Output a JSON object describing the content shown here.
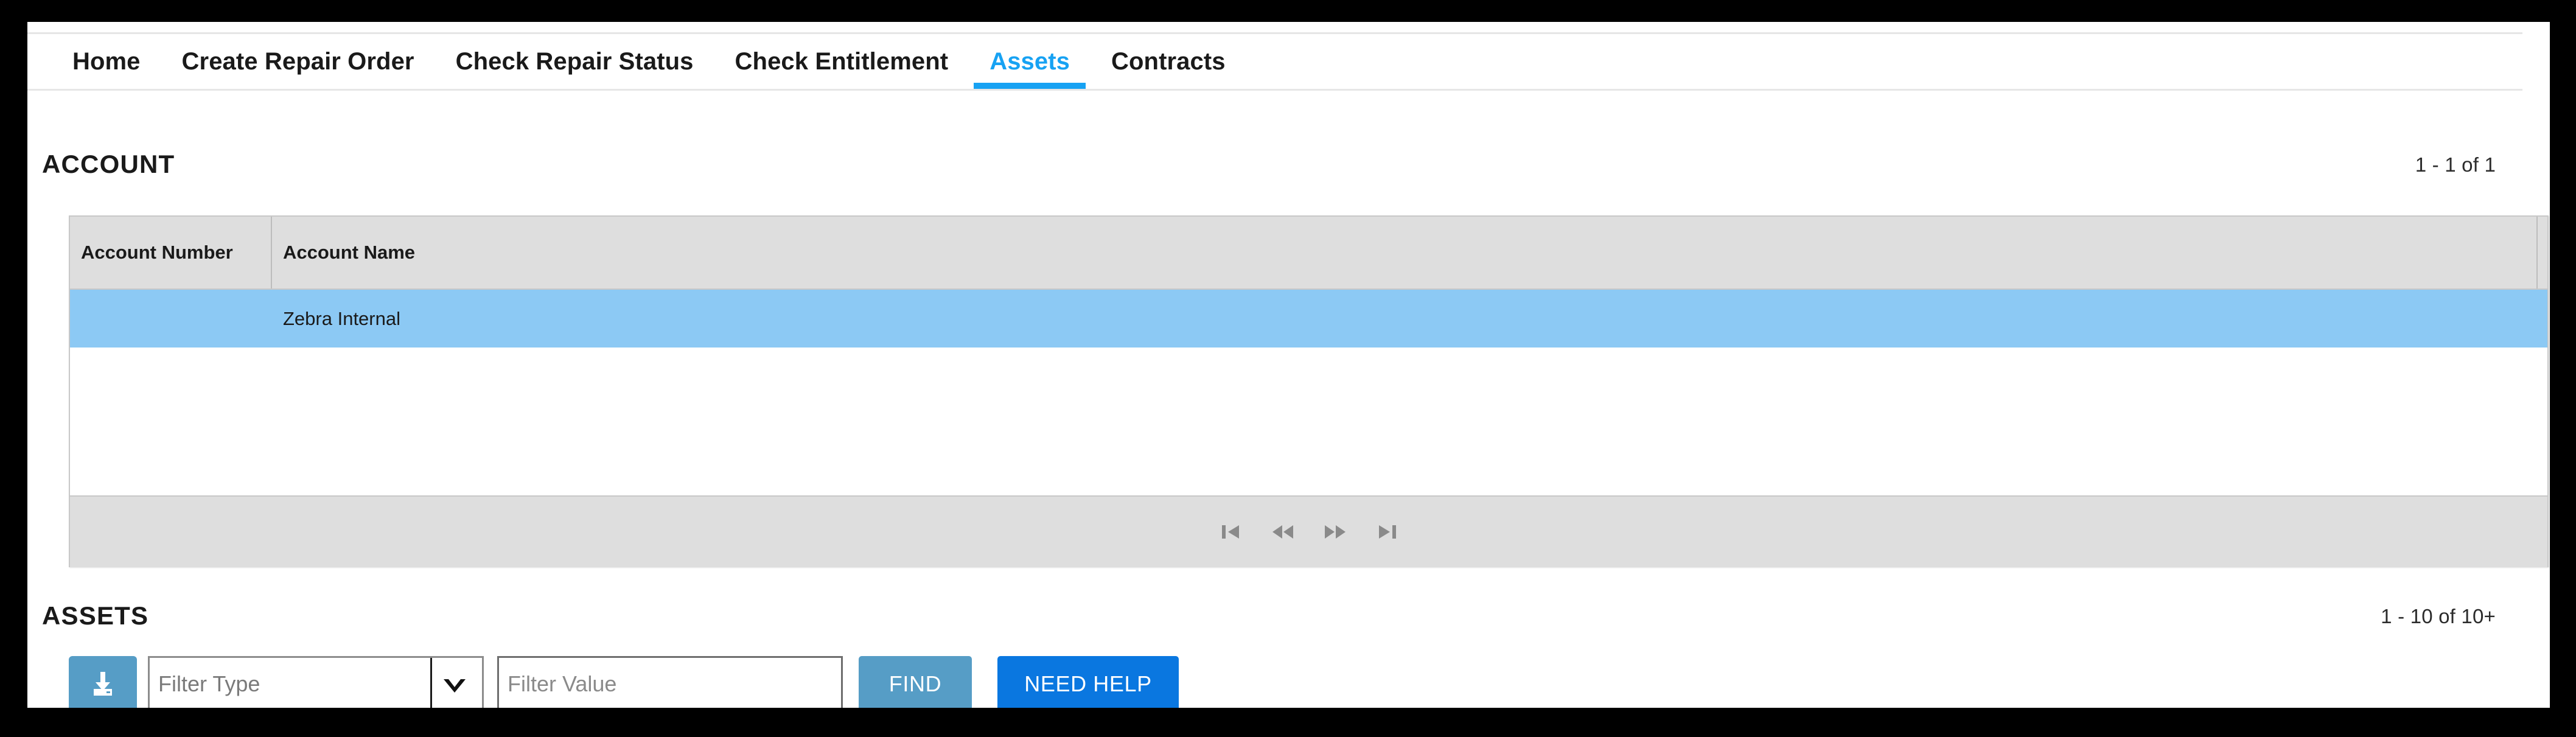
{
  "nav": {
    "tabs": [
      {
        "label": "Home",
        "active": false
      },
      {
        "label": "Create Repair Order",
        "active": false
      },
      {
        "label": "Check Repair Status",
        "active": false
      },
      {
        "label": "Check Entitlement",
        "active": false
      },
      {
        "label": "Assets",
        "active": true
      },
      {
        "label": "Contracts",
        "active": false
      }
    ],
    "active_color": "#17a2f3"
  },
  "account_section": {
    "title": "ACCOUNT",
    "count": "1 - 1 of 1",
    "table": {
      "columns": [
        "Account Number",
        "Account Name"
      ],
      "rows": [
        {
          "account_number": "",
          "account_name": "Zebra Internal",
          "selected": true
        }
      ],
      "selected_row_color": "#8cc9f4",
      "header_bg": "#dedede"
    },
    "pager": {
      "first_label": "First page",
      "prev_label": "Previous page",
      "next_label": "Next page",
      "last_label": "Last page"
    }
  },
  "assets_section": {
    "title": "ASSETS",
    "count": "1 - 10 of 10+",
    "toolbar": {
      "download_icon": "download-icon",
      "filter_type": {
        "selected": "Filter Type",
        "caret_icon": "chevron-down-icon"
      },
      "filter_value": {
        "value": "",
        "placeholder": "Filter Value"
      },
      "find_label": "FIND",
      "find_color": "#569dc6",
      "help_label": "NEED HELP",
      "help_color": "#0a77e0"
    }
  }
}
